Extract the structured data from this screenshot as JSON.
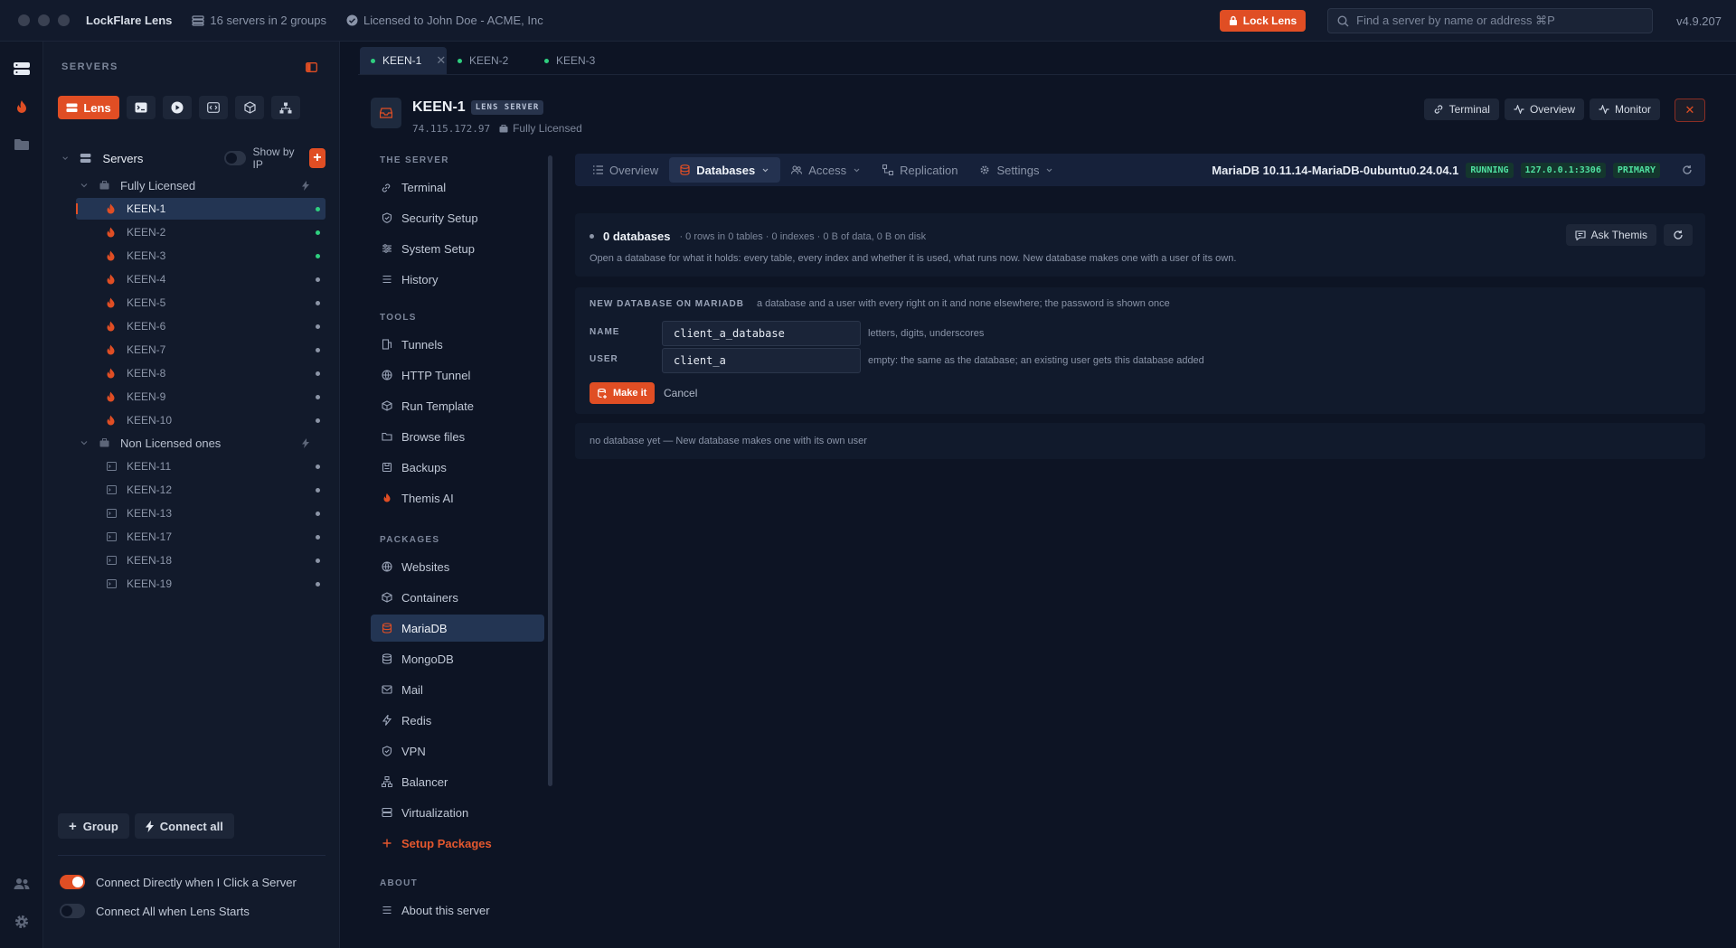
{
  "app": {
    "name": "LockFlare Lens",
    "servers_summary": "16 servers in 2 groups",
    "license": "Licensed to John Doe - ACME, Inc",
    "lock_label": "Lock Lens",
    "search_placeholder": "Find a server by name or address ⌘P",
    "version": "v4.9.207",
    "accent": "#e04e24"
  },
  "sidebar": {
    "title": "SERVERS",
    "lens_label": "Lens",
    "tree_title": "Servers",
    "show_by_ip": "Show by IP",
    "groups": [
      {
        "name": "Fully Licensed",
        "servers": [
          {
            "name": "KEEN-1",
            "status": "online",
            "selected": true
          },
          {
            "name": "KEEN-2",
            "status": "online"
          },
          {
            "name": "KEEN-3",
            "status": "online"
          },
          {
            "name": "KEEN-4",
            "status": "offline"
          },
          {
            "name": "KEEN-5",
            "status": "offline"
          },
          {
            "name": "KEEN-6",
            "status": "offline"
          },
          {
            "name": "KEEN-7",
            "status": "offline"
          },
          {
            "name": "KEEN-8",
            "status": "offline"
          },
          {
            "name": "KEEN-9",
            "status": "offline"
          },
          {
            "name": "KEEN-10",
            "status": "offline"
          }
        ]
      },
      {
        "name": "Non Licensed ones",
        "servers": [
          {
            "name": "KEEN-11",
            "status": "offline"
          },
          {
            "name": "KEEN-12",
            "status": "offline"
          },
          {
            "name": "KEEN-13",
            "status": "offline"
          },
          {
            "name": "KEEN-17",
            "status": "offline"
          },
          {
            "name": "KEEN-18",
            "status": "offline"
          },
          {
            "name": "KEEN-19",
            "status": "offline"
          }
        ]
      }
    ],
    "group_btn": "Group",
    "connect_all_btn": "Connect all",
    "opt_connect_directly": "Connect Directly when I Click a Server",
    "opt_connect_all": "Connect All when Lens Starts"
  },
  "tabs": [
    {
      "label": "KEEN-1",
      "active": true
    },
    {
      "label": "KEEN-2"
    },
    {
      "label": "KEEN-3"
    }
  ],
  "server": {
    "name": "KEEN-1",
    "tag": "LENS SERVER",
    "ip": "74.115.172.97",
    "license": "Fully Licensed",
    "btn_terminal": "Terminal",
    "btn_overview": "Overview",
    "btn_monitor": "Monitor"
  },
  "nav": {
    "sec_server": "THE SERVER",
    "sec_tools": "TOOLS",
    "sec_packages": "PACKAGES",
    "sec_about": "ABOUT",
    "server_items": [
      "Terminal",
      "Security Setup",
      "System Setup",
      "History"
    ],
    "tool_items": [
      "Tunnels",
      "HTTP Tunnel",
      "Run Template",
      "Browse files",
      "Backups",
      "Themis AI"
    ],
    "package_items": [
      "Websites",
      "Containers",
      "MariaDB",
      "MongoDB",
      "Mail",
      "Redis",
      "VPN",
      "Balancer",
      "Virtualization",
      "Setup Packages"
    ],
    "about_items": [
      "About this server"
    ]
  },
  "subtabs": {
    "overview": "Overview",
    "databases": "Databases",
    "access": "Access",
    "replication": "Replication",
    "settings": "Settings",
    "version": "MariaDB 10.11.14-MariaDB-0ubuntu0.24.04.1",
    "badge_running": "RUNNING",
    "badge_address": "127.0.0.1:3306",
    "badge_primary": "PRIMARY"
  },
  "databases": {
    "count": "0 databases",
    "stats": "· 0 rows in 0 tables · 0 indexes · 0 B of data, 0 B on disk",
    "description": "Open a database for what it holds: every table, every index and whether it is used, what runs now. New database makes one with a user of its own.",
    "ask_label": "Ask Themis"
  },
  "new_db": {
    "title": "NEW DATABASE ON MARIADB",
    "desc": "a database and a user with every right on it and none elsewhere; the password is shown once",
    "name_label": "NAME",
    "name_value": "client_a_database",
    "name_hint": "letters, digits, underscores",
    "user_label": "USER",
    "user_value": "client_a",
    "user_hint": "empty: the same as the database; an existing user gets this database added",
    "make_label": "Make it",
    "cancel_label": "Cancel"
  },
  "empty_state": "no database yet — New database makes one with its own user"
}
